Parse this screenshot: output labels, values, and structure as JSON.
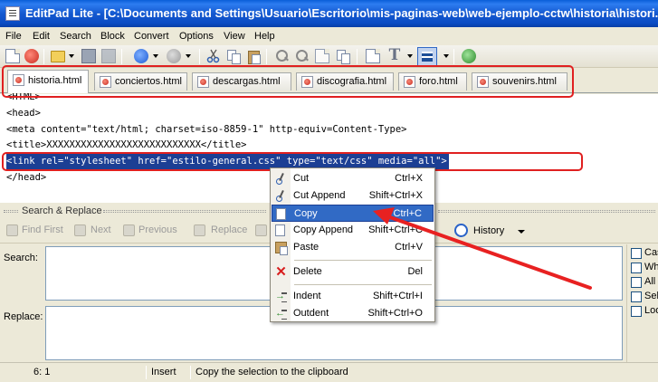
{
  "window": {
    "title": "EditPad Lite - [C:\\Documents and Settings\\Usuario\\Escritorio\\mis-paginas-web\\web-ejemplo-cctw\\historia\\histori..."
  },
  "menu": [
    "File",
    "Edit",
    "Search",
    "Block",
    "Convert",
    "Options",
    "View",
    "Help"
  ],
  "toolbar_icons": [
    "new-icon",
    "close-icon",
    "open-icon",
    "save-icon",
    "save-all-icon",
    "undo-icon",
    "redo-icon",
    "cut-icon",
    "copy-icon",
    "paste-icon",
    "find-icon",
    "replace-icon",
    "insert-icon",
    "text-format-icon",
    "block-select-icon",
    "web-icon"
  ],
  "tabs": [
    {
      "label": "historia.html",
      "active": true
    },
    {
      "label": "conciertos.html"
    },
    {
      "label": "descargas.html"
    },
    {
      "label": "discografia.html"
    },
    {
      "label": "foro.html"
    },
    {
      "label": "souvenirs.html"
    }
  ],
  "editor": {
    "lines": [
      "<HTML>",
      "<head>",
      "<meta content=\"text/html; charset=iso-8859-1\" http-equiv=Content-Type>",
      "<title>XXXXXXXXXXXXXXXXXXXXXXXXXXX</title>",
      "<link rel=\"stylesheet\" href=\"estilo-general.css\" type=\"text/css\" media=\"all\">",
      "</head>"
    ],
    "selected_line": 4
  },
  "search_replace": {
    "title": "Search & Replace",
    "buttons": [
      "Find First",
      "Next",
      "Previous",
      "Replace",
      "Re"
    ],
    "history_label": "History",
    "search_label": "Search:",
    "replace_label": "Replace:",
    "search_value": "",
    "replace_value": "",
    "options": [
      "Cas",
      "Wh",
      "All",
      "Sele",
      "Loo"
    ]
  },
  "context_menu": {
    "items": [
      {
        "label": "Cut",
        "shortcut": "Ctrl+X",
        "icon": "scissors-icon"
      },
      {
        "label": "Cut Append",
        "shortcut": "Shift+Ctrl+X",
        "icon": "scissors-icon"
      },
      {
        "label": "Copy",
        "shortcut": "Ctrl+C",
        "icon": "copy-icon",
        "highlighted": true
      },
      {
        "label": "Copy Append",
        "shortcut": "Shift+Ctrl+C",
        "icon": "copy-icon"
      },
      {
        "label": "Paste",
        "shortcut": "Ctrl+V",
        "icon": "paste-icon"
      },
      {
        "label": "Delete",
        "shortcut": "Del",
        "icon": "delete-icon"
      },
      {
        "label": "Indent",
        "shortcut": "Shift+Ctrl+I",
        "icon": "indent-icon"
      },
      {
        "label": "Outdent",
        "shortcut": "Shift+Ctrl+O",
        "icon": "outdent-icon"
      }
    ]
  },
  "status": {
    "position": "6: 1",
    "mode": "Insert",
    "message": "Copy the selection to the clipboard"
  },
  "colors": {
    "selection": "#1c3f94",
    "menu_highlight": "#316ac5",
    "annotation": "#e02020"
  }
}
